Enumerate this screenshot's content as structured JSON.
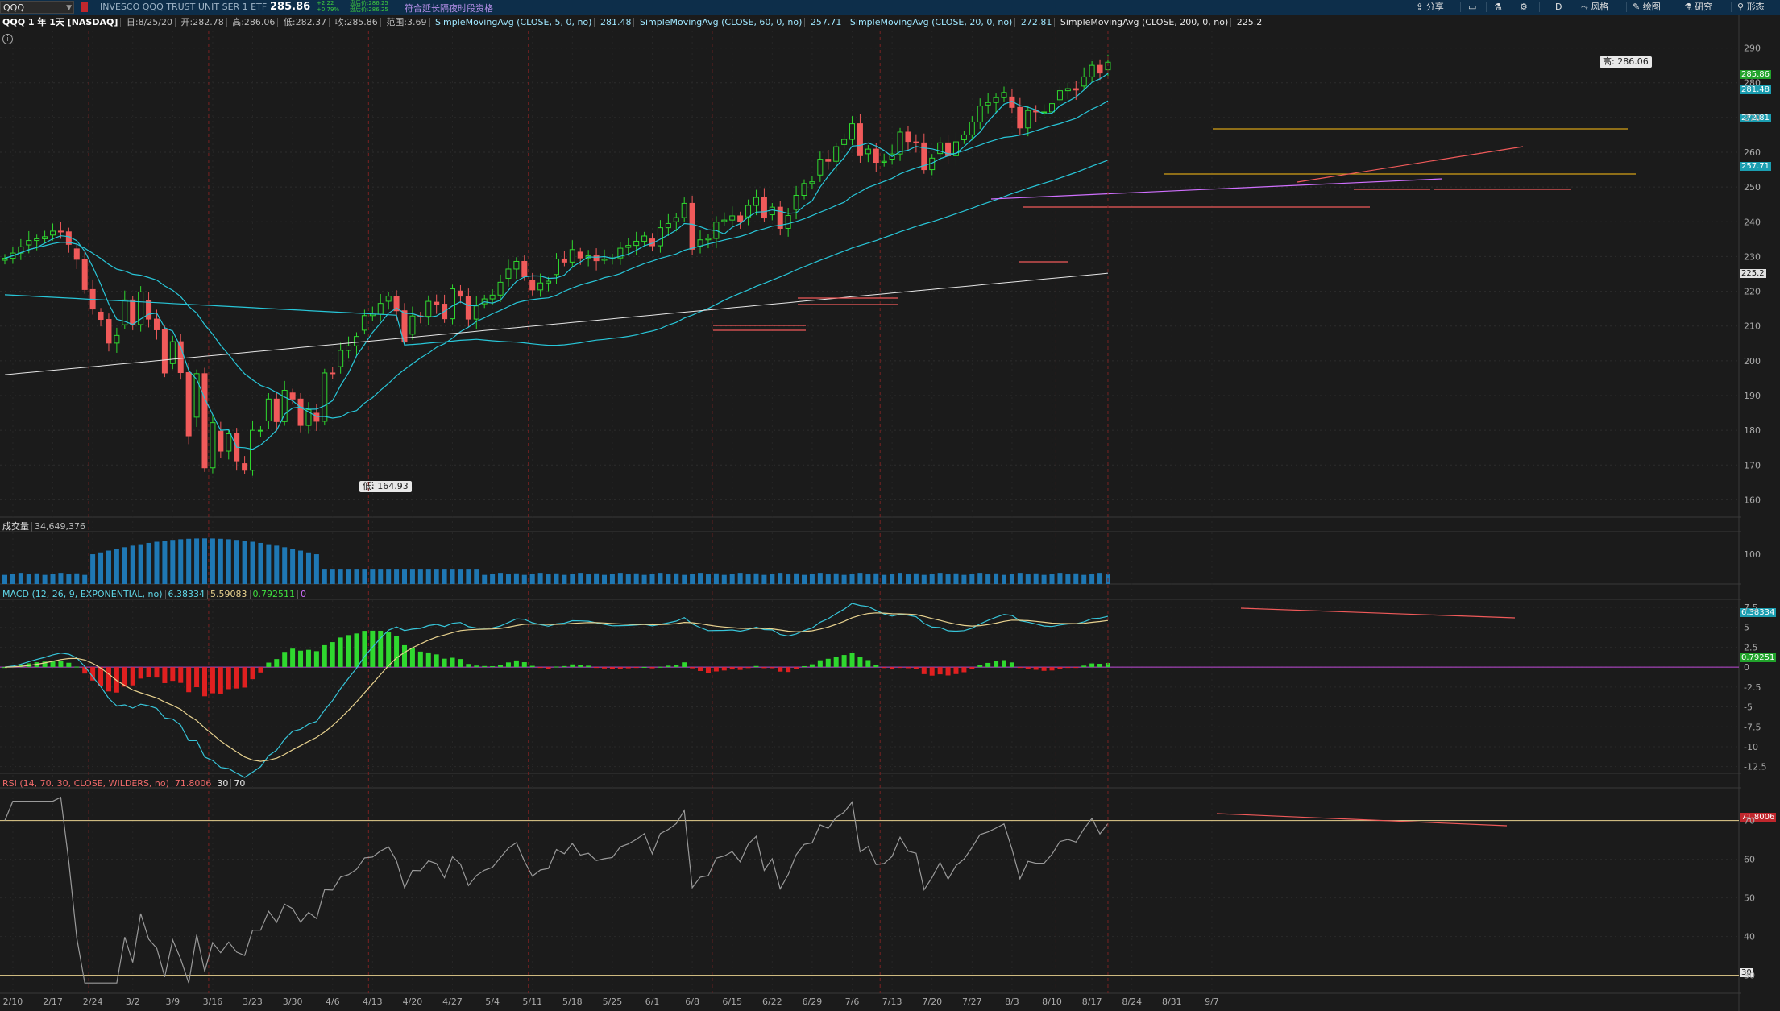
{
  "toolbar": {
    "symbol": "QQQ",
    "security_name": "INVESCO QQQ TRUST UNIT SER 1 ETF",
    "last_price": "285.86",
    "change_abs": "+2.22",
    "change_pct": "+0.79%",
    "ext_bid": "盘后价:286.25",
    "ext_ask": "盘后价:286.25",
    "ext_note": "符合延长隔夜时段资格",
    "share": "分享",
    "period": "D",
    "style": "风格",
    "draw": "绘图",
    "study": "研究",
    "pattern": "形态"
  },
  "info": {
    "title": "QQQ 1 年 1天 [NASDAQ]",
    "date": "日:8/25/20",
    "open": "开:282.78",
    "high": "高:286.06",
    "low": "低:282.37",
    "close": "收:285.86",
    "range": "范围:3.69",
    "sma5_label": "SimpleMovingAvg (CLOSE, 5, 0, no)",
    "sma5": "281.48",
    "sma60_label": "SimpleMovingAvg (CLOSE, 60, 0, no)",
    "sma60": "257.71",
    "sma20_label": "SimpleMovingAvg (CLOSE, 20, 0, no)",
    "sma20": "272.81",
    "sma200_label": "SimpleMovingAvg (CLOSE, 200, 0, no)",
    "sma200": "225.2"
  },
  "volume": {
    "label": "成交量",
    "value": "34,649,376",
    "axis_tick": "100"
  },
  "macd": {
    "label": "MACD (12, 26, 9, EXPONENTIAL, no)",
    "value": "6.38334",
    "avg": "5.59083",
    "diff": "0.792511",
    "zero": "0",
    "last_tag": "6.38334",
    "diff_tag": "0.79251"
  },
  "rsi": {
    "label": "RSI (14, 70, 30, CLOSE, WILDERS, no)",
    "value": "71.8006",
    "os": "30",
    "ob": "70",
    "last_tag": "71.8006",
    "ob_tag": "30"
  },
  "price_tags": {
    "last": "285.86",
    "sma5": "281.48",
    "sma20": "272.81",
    "sma60": "257.71",
    "sma200": "225.2"
  },
  "callouts": {
    "high": "高: 286.06",
    "low": "低: 164.93"
  },
  "colors": {
    "up": "#2fd82f",
    "down": "#f05a5a",
    "sma5": "#28c6d8",
    "sma20": "#28c6d8",
    "sma60": "#28c6d8",
    "sma200": "#e6e6e6",
    "macd": "#37c5d9",
    "macd_avg": "#e8d28f",
    "rsi": "#9a9a9a",
    "bg": "#1b1b1b",
    "volume": "#1f78b4"
  },
  "chart_data": {
    "type": "candlestick",
    "symbol": "QQQ",
    "dates": [
      "2/7",
      "2/10",
      "2/11",
      "2/12",
      "2/13",
      "2/14",
      "2/18",
      "2/19",
      "2/20",
      "2/21",
      "2/24",
      "2/25",
      "2/26",
      "2/27",
      "2/28",
      "3/2",
      "3/3",
      "3/4",
      "3/5",
      "3/6",
      "3/9",
      "3/10",
      "3/11",
      "3/12",
      "3/13",
      "3/16",
      "3/17",
      "3/18",
      "3/19",
      "3/20",
      "3/23",
      "3/24",
      "3/25",
      "3/26",
      "3/27",
      "3/30",
      "3/31",
      "4/1",
      "4/2",
      "4/3",
      "4/6",
      "4/7",
      "4/8",
      "4/9",
      "4/13",
      "4/14",
      "4/15",
      "4/16",
      "4/17",
      "4/20",
      "4/21",
      "4/22",
      "4/23",
      "4/24",
      "4/27",
      "4/28",
      "4/29",
      "4/30",
      "5/1",
      "5/4",
      "5/5",
      "5/6",
      "5/7",
      "5/8",
      "5/11",
      "5/12",
      "5/13",
      "5/14",
      "5/15",
      "5/18",
      "5/19",
      "5/20",
      "5/21",
      "5/22",
      "5/26",
      "5/27",
      "5/28",
      "5/29",
      "6/1",
      "6/2",
      "6/3",
      "6/4",
      "6/5",
      "6/8",
      "6/9",
      "6/10",
      "6/11",
      "6/12",
      "6/15",
      "6/16",
      "6/17",
      "6/18",
      "6/19",
      "6/22",
      "6/23",
      "6/24",
      "6/25",
      "6/26",
      "6/29",
      "6/30",
      "7/1",
      "7/2",
      "7/6",
      "7/7",
      "7/8",
      "7/9",
      "7/10",
      "7/13",
      "7/14",
      "7/15",
      "7/16",
      "7/17",
      "7/20",
      "7/21",
      "7/22",
      "7/23",
      "7/24",
      "7/27",
      "7/28",
      "7/29",
      "7/30",
      "7/31",
      "8/3",
      "8/4",
      "8/5",
      "8/6",
      "8/7",
      "8/10",
      "8/11",
      "8/12",
      "8/13",
      "8/14",
      "8/17",
      "8/18",
      "8/19",
      "8/20",
      "8/21",
      "8/24",
      "8/25"
    ],
    "close": [
      229.5,
      231.0,
      232.8,
      234.6,
      235.1,
      235.7,
      237.3,
      237.1,
      233.5,
      229.2,
      220.5,
      214.9,
      211.9,
      205.1,
      207.3,
      217.5,
      210.4,
      219.8,
      212.0,
      208.9,
      196.5,
      205.5,
      196.6,
      178.4,
      196.3,
      169.2,
      182.2,
      174.0,
      179.0,
      171.2,
      168.5,
      180.0,
      180.0,
      189.0,
      182.5,
      191.5,
      189.0,
      181.4,
      185.9,
      182.6,
      196.5,
      196.3,
      203.0,
      204.3,
      207.0,
      213.0,
      213.4,
      216.5,
      218.6,
      214.4,
      205.4,
      212.9,
      212.8,
      217.1,
      216.3,
      212.1,
      220.7,
      218.6,
      212.0,
      215.8,
      217.8,
      218.9,
      222.6,
      226.4,
      228.6,
      224.2,
      220.4,
      222.4,
      222.9,
      229.3,
      228.4,
      232.0,
      229.6,
      230.2,
      228.8,
      229.3,
      229.6,
      232.4,
      233.2,
      234.4,
      235.9,
      233.1,
      238.3,
      239.5,
      241.2,
      245.3,
      232.1,
      234.8,
      235.2,
      239.9,
      240.5,
      241.7,
      240.0,
      244.7,
      247.0,
      241.1,
      244.2,
      238.1,
      241.8,
      247.6,
      251.0,
      251.5,
      258.0,
      257.4,
      261.6,
      263.7,
      268.2,
      259.0,
      260.9,
      257.1,
      257.4,
      259.5,
      265.8,
      263.1,
      262.7,
      255.0,
      258.3,
      262.7,
      259.0,
      263.0,
      265.0,
      268.7,
      273.3,
      274.3,
      275.7,
      277.2,
      272.9,
      267.0,
      272.0,
      271.6,
      271.6,
      274.0,
      277.7,
      278.3,
      277.9,
      281.7,
      285.0,
      282.8,
      285.9
    ],
    "sma5_last": 281.48,
    "sma20_last": 272.81,
    "sma60_last": 257.71,
    "sma200_last": 225.2,
    "high_value": 286.06,
    "low_value": 164.93,
    "y_axis_ticks": [
      160,
      170,
      180,
      190,
      200,
      210,
      220,
      230,
      240,
      250,
      260,
      270,
      280,
      290
    ],
    "x_axis_ticks": [
      "2/10",
      "2/17",
      "2/24",
      "3/2",
      "3/9",
      "3/16",
      "3/23",
      "3/30",
      "4/6",
      "4/13",
      "4/20",
      "4/27",
      "5/4",
      "5/11",
      "5/18",
      "5/25",
      "6/1",
      "6/8",
      "6/15",
      "6/22",
      "6/29",
      "7/6",
      "7/13",
      "7/20",
      "7/27",
      "8/3",
      "8/10",
      "8/17",
      "8/24",
      "8/31",
      "9/7"
    ],
    "macd_ticks": [
      "7.5",
      "5",
      "2.5",
      "0",
      "-2.5",
      "-5",
      "-7.5",
      "-10",
      "-12.5"
    ],
    "rsi_ticks": [
      "70",
      "60",
      "50",
      "40",
      "30"
    ],
    "ylim": [
      155,
      295
    ]
  }
}
